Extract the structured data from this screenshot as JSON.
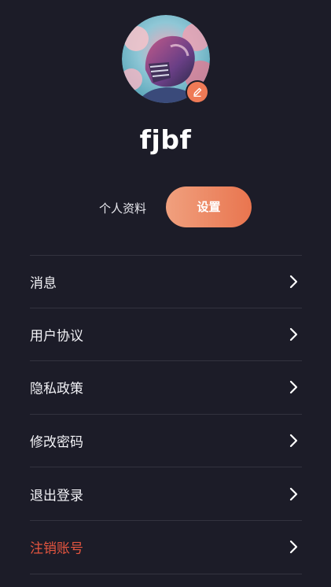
{
  "profile": {
    "username": "fjbf",
    "avatar_icon": "football-helmet-avatar",
    "edit_icon": "pencil-icon"
  },
  "actions": {
    "profile_label": "个人资料",
    "settings_label": "设置"
  },
  "menu": {
    "items": [
      {
        "label": "消息",
        "icon": "chevron-right-icon"
      },
      {
        "label": "用户协议",
        "icon": "chevron-right-icon"
      },
      {
        "label": "隐私政策",
        "icon": "chevron-right-icon"
      },
      {
        "label": "修改密码",
        "icon": "chevron-right-icon"
      },
      {
        "label": "退出登录",
        "icon": "chevron-right-icon"
      },
      {
        "label": "注销账号",
        "icon": "chevron-right-icon"
      }
    ]
  },
  "colors": {
    "background": "#1c1c28",
    "accent": "#ef7a56",
    "danger": "#e4553f",
    "divider": "#33333f"
  }
}
